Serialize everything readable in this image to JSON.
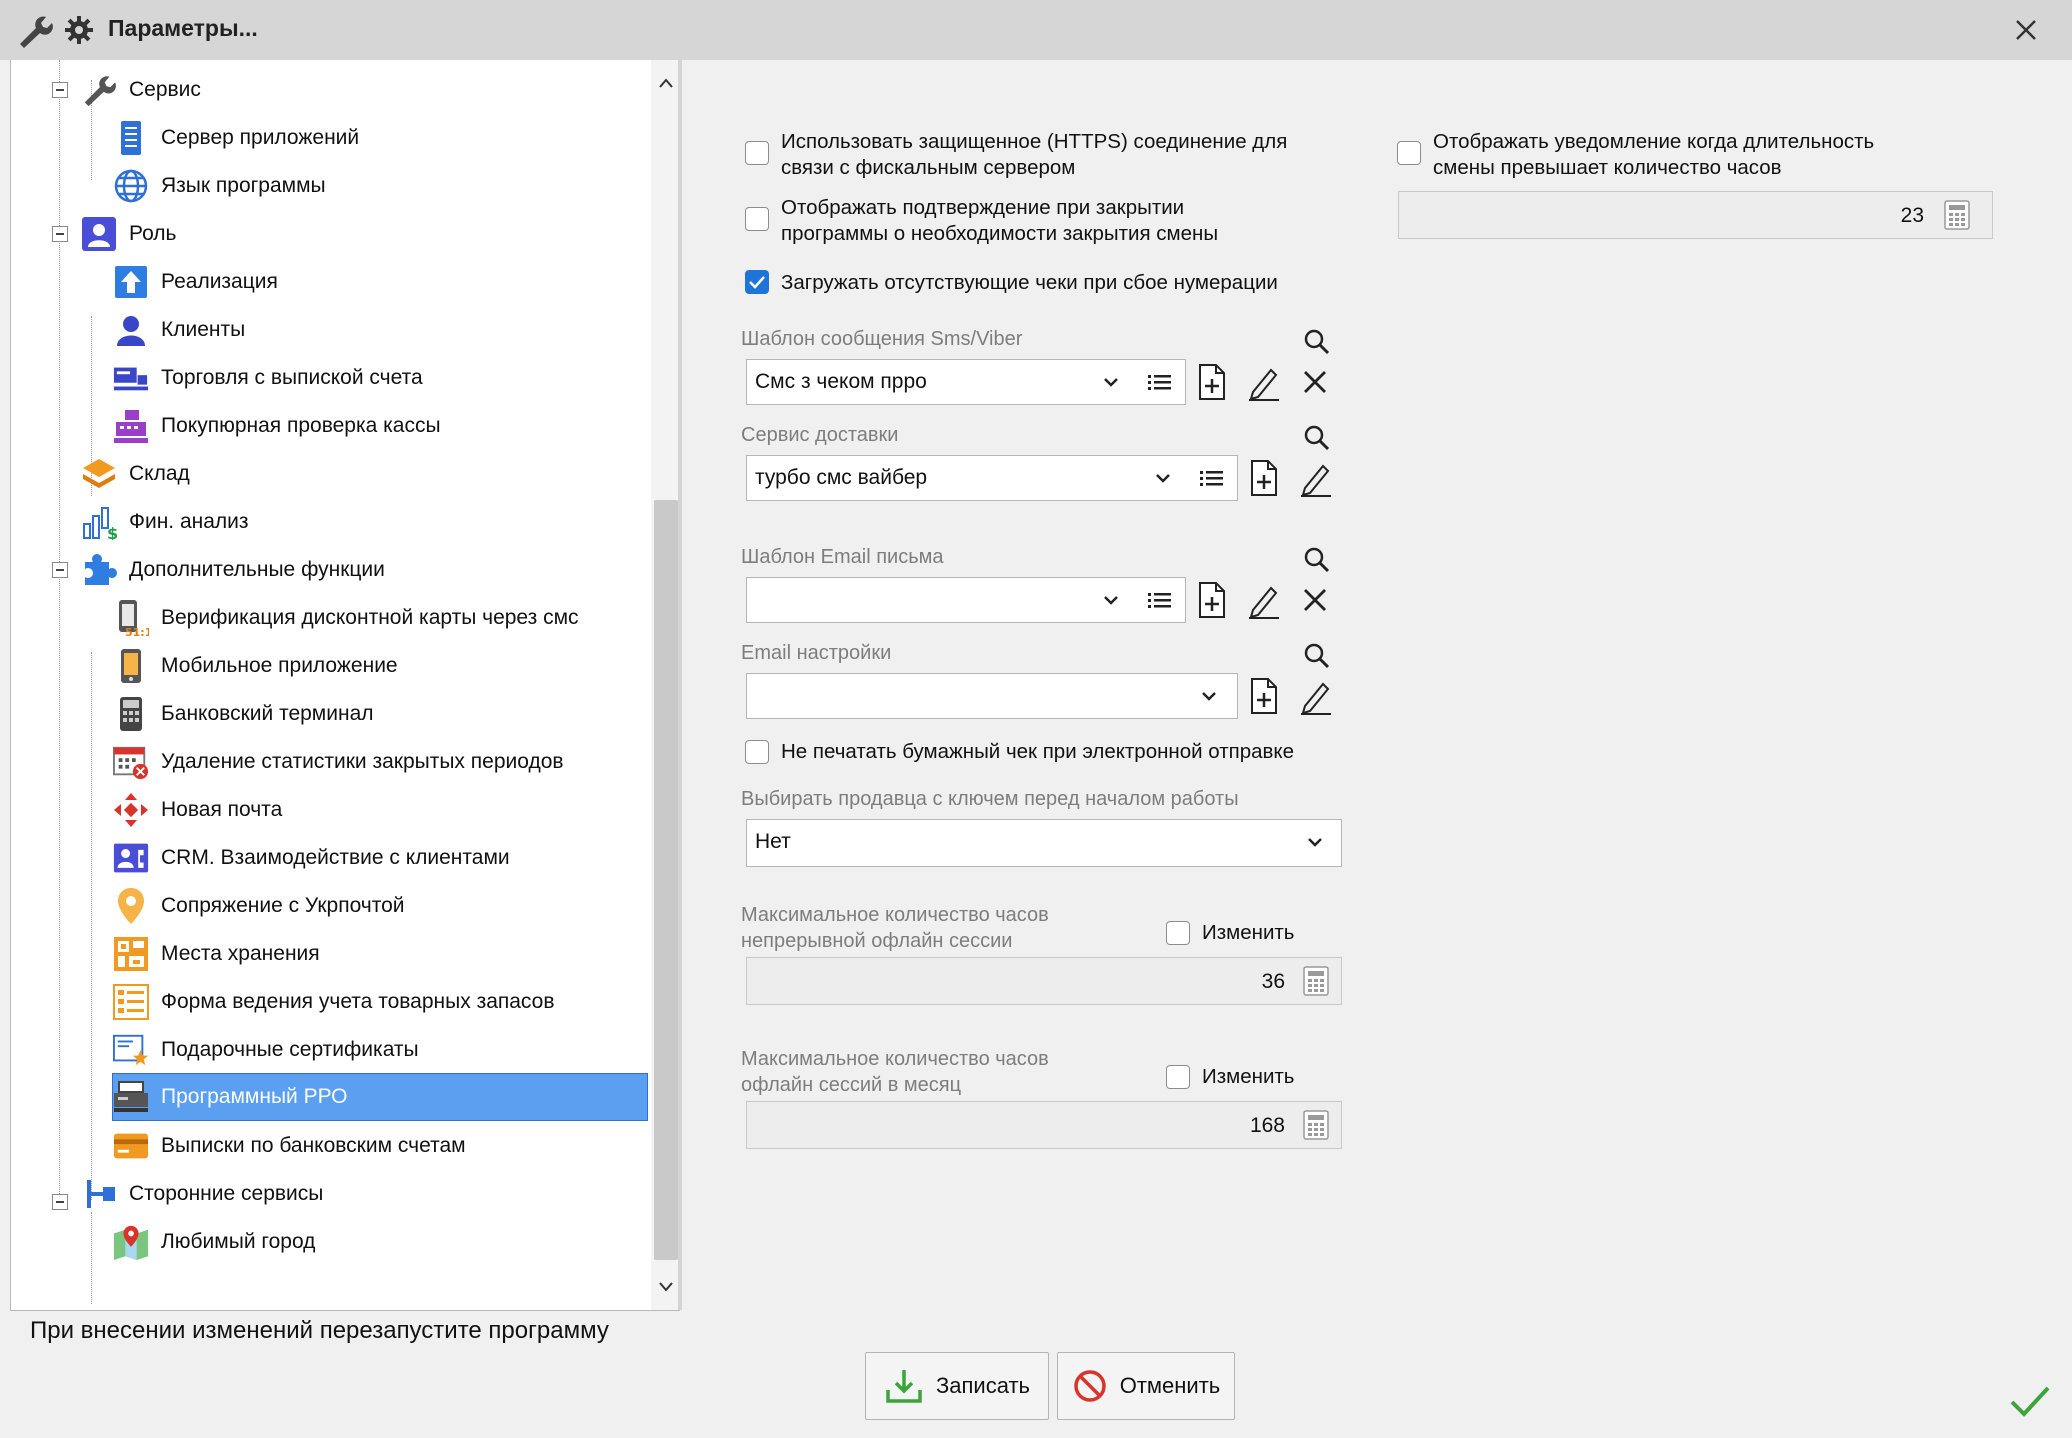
{
  "window": {
    "title": "Параметры...",
    "icons": [
      "wrench-icon",
      "gear-icon",
      "close-icon"
    ]
  },
  "tree": {
    "items": [
      {
        "label": "Сервис",
        "icon": "wrench-icon",
        "level": 0,
        "expanded": true
      },
      {
        "label": "Сервер приложений",
        "icon": "server-icon",
        "level": 1
      },
      {
        "label": "Язык программы",
        "icon": "globe-icon",
        "level": 1
      },
      {
        "label": "Роль",
        "icon": "user-role-icon",
        "level": 0,
        "expanded": true
      },
      {
        "label": "Реализация",
        "icon": "upload-arrow-icon",
        "level": 1
      },
      {
        "label": "Клиенты",
        "icon": "client-icon",
        "level": 1
      },
      {
        "label": "Торговля с выпиской счета",
        "icon": "invoice-trade-icon",
        "level": 1
      },
      {
        "label": "Покупюрная проверка кассы",
        "icon": "cash-register-icon",
        "level": 1
      },
      {
        "label": "Склад",
        "icon": "warehouse-layers-icon",
        "level": 0
      },
      {
        "label": "Фин. анализ",
        "icon": "finance-chart-icon",
        "level": 0
      },
      {
        "label": "Дополнительные функции",
        "icon": "puzzle-icon",
        "level": 0,
        "expanded": true
      },
      {
        "label": "Верификация дисконтной карты через смс",
        "icon": "phone-sms-icon",
        "level": 1
      },
      {
        "label": "Мобильное приложение",
        "icon": "mobile-phone-icon",
        "level": 1
      },
      {
        "label": "Банковский терминал",
        "icon": "bank-terminal-icon",
        "level": 1
      },
      {
        "label": "Удаление статистики закрытых периодов",
        "icon": "calendar-delete-icon",
        "level": 1
      },
      {
        "label": "Новая почта",
        "icon": "nova-poshta-icon",
        "level": 1
      },
      {
        "label": "CRM. Взаимодействие с клиентами",
        "icon": "crm-icon",
        "level": 1
      },
      {
        "label": "Сопряжение с Укрпочтой",
        "icon": "location-pin-icon",
        "level": 1
      },
      {
        "label": "Места хранения",
        "icon": "storage-places-icon",
        "level": 1
      },
      {
        "label": "Форма ведения учета товарных запасов",
        "icon": "inventory-form-icon",
        "level": 1
      },
      {
        "label": "Подарочные сертификаты",
        "icon": "gift-certificate-icon",
        "level": 1
      },
      {
        "label": "Программный РРО",
        "icon": "software-rro-icon",
        "level": 1,
        "selected": true
      },
      {
        "label": "Выписки по банковским счетам",
        "icon": "bank-card-icon",
        "level": 1
      },
      {
        "label": "Сторонние сервисы",
        "icon": "third-party-icon",
        "level": 0,
        "expanded": true
      },
      {
        "label": "Любимый город",
        "icon": "map-city-icon",
        "level": 1
      }
    ]
  },
  "settings": {
    "https_checkbox": {
      "label_line1": "Использовать защищенное (HTTPS) соединение для",
      "label_line2": "связи с фискальным сервером",
      "checked": false
    },
    "confirm_checkbox": {
      "label_line1": "Отображать подтверждение при закрытии",
      "label_line2": "программы о необходимости закрытия смены",
      "checked": false
    },
    "load_checks_checkbox": {
      "label": "Загружать отсутствующие чеки при сбое нумерации",
      "checked": true
    },
    "shift_notify_checkbox": {
      "label_line1": "Отображать уведомление когда длительность",
      "label_line2": "смены превышает количество часов",
      "checked": false
    },
    "shift_hours_value": "23",
    "sms_template": {
      "label": "Шаблон сообщения Sms/Viber",
      "value": "Смс з чеком прро"
    },
    "delivery_service": {
      "label": "Сервис доставки",
      "value": "турбо смс вайбер"
    },
    "email_template": {
      "label": "Шаблон Email письма",
      "value": ""
    },
    "email_settings": {
      "label": "Email настройки",
      "value": ""
    },
    "no_paper_checkbox": {
      "label": "Не печатать бумажный чек при электронной отправке",
      "checked": false
    },
    "select_seller": {
      "label": "Выбирать продавца с ключем перед началом работы",
      "value": "Нет"
    },
    "max_offline_session": {
      "label_line1": "Максимальное количество часов",
      "label_line2": "непрерывной офлайн сессии",
      "change_label": "Изменить",
      "value": "36"
    },
    "max_offline_month": {
      "label_line1": "Максимальное количество часов",
      "label_line2": "офлайн сессий в месяц",
      "change_label": "Изменить",
      "value": "168"
    }
  },
  "footer": {
    "status_text": "При внесении изменений перезапустите программу",
    "save_label": "Записать",
    "cancel_label": "Отменить"
  },
  "colors": {
    "selection": "#5a9ff0",
    "checkbox_checked": "#1f74d8",
    "save_icon": "#3aa63a",
    "cancel_icon": "#d9342b",
    "ok_mark": "#3aa63a"
  }
}
